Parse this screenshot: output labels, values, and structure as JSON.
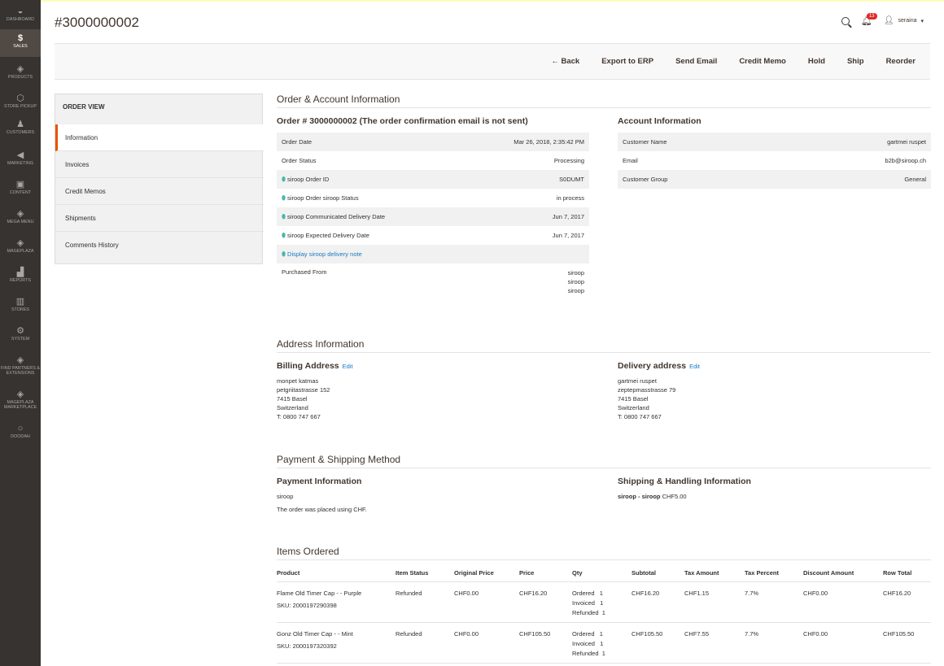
{
  "sidebar": {
    "items": [
      {
        "label": "Dashboard",
        "icon": "dashboard-icon"
      },
      {
        "label": "Sales",
        "icon": "dollar-icon"
      },
      {
        "label": "Products",
        "icon": "box-icon"
      },
      {
        "label": "Store Pickup",
        "icon": "store-pickup-icon"
      },
      {
        "label": "Customers",
        "icon": "person-icon"
      },
      {
        "label": "Marketing",
        "icon": "megaphone-icon"
      },
      {
        "label": "Content",
        "icon": "content-icon"
      },
      {
        "label": "Mega Menu",
        "icon": "cube-icon"
      },
      {
        "label": "Mageplaza",
        "icon": "cube-icon"
      },
      {
        "label": "Reports",
        "icon": "bar-chart-icon"
      },
      {
        "label": "Stores",
        "icon": "shop-icon"
      },
      {
        "label": "System",
        "icon": "gear-icon"
      },
      {
        "label": "Find Partners & Extensions",
        "icon": "cube-icon"
      },
      {
        "label": "Mageplaza Marketplace",
        "icon": "cube-icon"
      },
      {
        "label": "Doodah",
        "icon": "circle-icon"
      }
    ]
  },
  "header": {
    "title": "#3000000002",
    "notifications": "13",
    "user": "seraina"
  },
  "actions": [
    "Back",
    "Export to ERP",
    "Send Email",
    "Credit Memo",
    "Hold",
    "Ship",
    "Reorder"
  ],
  "order_view": {
    "title": "ORDER VIEW",
    "tabs": [
      "Information",
      "Invoices",
      "Credit Memos",
      "Shipments",
      "Comments History"
    ]
  },
  "order_account": {
    "section_title": "Order & Account Information",
    "order_heading": "Order # 3000000002 (The order confirmation email is not sent)",
    "order_rows": [
      {
        "label": "Order Date",
        "value": "Mar 26, 2018, 2:35:42 PM"
      },
      {
        "label": "Order Status",
        "value": "Processing"
      },
      {
        "label": "siroop Order ID",
        "value": "S0DUMT"
      },
      {
        "label": "siroop Order siroop Status",
        "value": "in process"
      },
      {
        "label": "siroop Communicated Delivery Date",
        "value": "Jun 7, 2017"
      },
      {
        "label": "siroop Expected Delivery Date",
        "value": "Jun 7, 2017"
      },
      {
        "label": "Display siroop delivery note",
        "value": ""
      }
    ],
    "purchased_from": {
      "label": "Purchased From",
      "values": [
        "siroop",
        "siroop",
        "siroop"
      ]
    },
    "account_heading": "Account Information",
    "account_rows": [
      {
        "label": "Customer Name",
        "value": "gartmei ruspet"
      },
      {
        "label": "Email",
        "value": "b2b@siroop.ch"
      },
      {
        "label": "Customer Group",
        "value": "General"
      }
    ]
  },
  "address": {
    "section_title": "Address Information",
    "edit_label": "Edit",
    "billing": {
      "heading": "Billing Address",
      "lines": [
        "monpet katmas",
        "petgriitastrasse 152",
        "7415 Basel",
        "Switzerland",
        "T: 0800 747 667"
      ]
    },
    "delivery": {
      "heading": "Delivery address",
      "lines": [
        "gartmei ruspet",
        "zeptepmasstrasse 79",
        "7415 Basel",
        "Switzerland",
        "T: 0800 747 667"
      ]
    }
  },
  "payment": {
    "section_title": "Payment & Shipping Method",
    "payment_heading": "Payment Information",
    "payment_method": "siroop",
    "payment_note": "The order was placed using CHF.",
    "shipping_heading": "Shipping & Handling Information",
    "shipping_method": "siroop - siroop",
    "shipping_price": "CHF5.00"
  },
  "items": {
    "section_title": "Items Ordered",
    "columns": [
      "Product",
      "Item Status",
      "Original Price",
      "Price",
      "Qty",
      "Subtotal",
      "Tax Amount",
      "Tax Percent",
      "Discount Amount",
      "Row Total"
    ],
    "rows": [
      {
        "name": "Flame Old Timer Cap - - Purple",
        "sku": "SKU: 2000197290398",
        "status": "Refunded",
        "original_price": "CHF0.00",
        "price": "CHF16.20",
        "qty_ordered": "Ordered   1",
        "qty_invoiced": "Invoiced   1",
        "qty_refunded": "Refunded  1",
        "subtotal": "CHF16.20",
        "tax_amount": "CHF1.15",
        "tax_percent": "7.7%",
        "discount": "CHF0.00",
        "row_total": "CHF16.20"
      },
      {
        "name": "Gonz Old Timer Cap - - Mint",
        "sku": "SKU: 2000197320392",
        "status": "Refunded",
        "original_price": "CHF0.00",
        "price": "CHF105.50",
        "qty_ordered": "Ordered   1",
        "qty_invoiced": "Invoiced   1",
        "qty_refunded": "Refunded  1",
        "subtotal": "CHF105.50",
        "tax_amount": "CHF7.55",
        "tax_percent": "7.7%",
        "discount": "CHF0.00",
        "row_total": "CHF105.50"
      }
    ]
  }
}
